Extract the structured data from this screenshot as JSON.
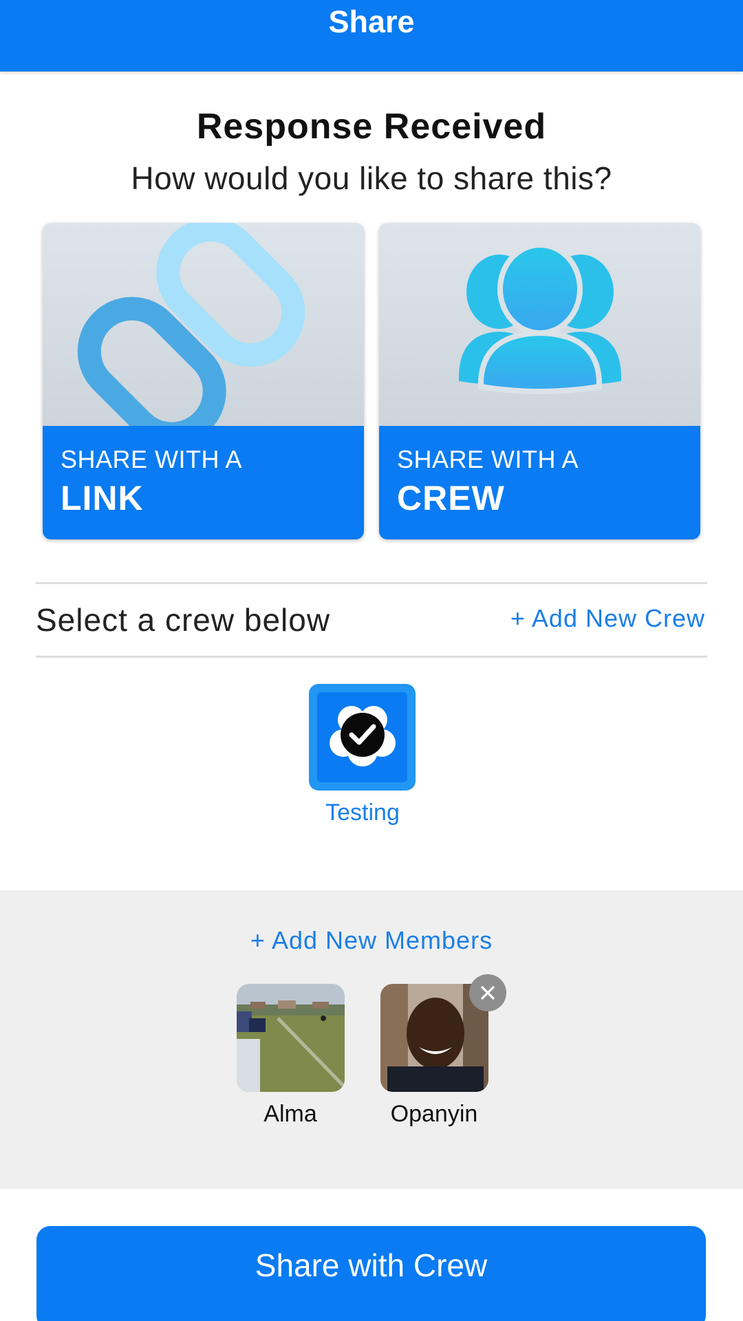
{
  "header": {
    "title": "Share"
  },
  "main": {
    "heading": "Response Received",
    "subheading": "How would you like to share this?",
    "options": [
      {
        "line1": "SHARE WITH A",
        "line2": "LINK",
        "icon": "link-icon"
      },
      {
        "line1": "SHARE WITH A",
        "line2": "CREW",
        "icon": "group-icon"
      }
    ]
  },
  "crews": {
    "prompt": "Select a crew below",
    "add_label": "+ Add New Crew",
    "items": [
      {
        "name": "Testing",
        "selected": true,
        "icon": "check-icon"
      }
    ]
  },
  "members": {
    "add_label": "+ Add New Members",
    "items": [
      {
        "name": "Alma",
        "removable": false
      },
      {
        "name": "Opanyin",
        "removable": true
      }
    ]
  },
  "actions": {
    "share_label": "Share with Crew"
  },
  "colors": {
    "primary": "#0a7bf2",
    "link_text": "#1a7ee8",
    "panel_bg": "#efefef"
  }
}
